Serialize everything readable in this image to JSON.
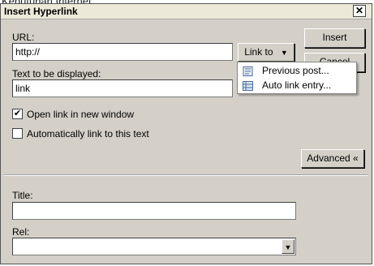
{
  "background_text": "Kebutuhan Internet",
  "dialog": {
    "title": "Insert Hyperlink",
    "close_glyph": "✕",
    "url_label": "URL:",
    "url_value": "http://",
    "link_to_label": "Link to",
    "insert_label": "Insert",
    "cancel_label": "Cancel",
    "display_text_label": "Text to be displayed:",
    "display_text_value": "link",
    "open_new_window_label": "Open link in new window",
    "open_new_window_checked": true,
    "auto_link_label": "Automatically link to this text",
    "auto_link_checked": false,
    "advanced_label": "Advanced «",
    "title_label": "Title:",
    "title_value": "",
    "rel_label": "Rel:",
    "rel_value": ""
  },
  "link_to_menu": {
    "items": [
      {
        "label": "Previous post...",
        "icon": "document-icon"
      },
      {
        "label": "Auto link entry...",
        "icon": "list-icon"
      }
    ]
  },
  "colors": {
    "dialog_bg": "#d4d0c8",
    "titlebar_bg": "#ece9d8",
    "menu_bg": "#ffffff"
  }
}
